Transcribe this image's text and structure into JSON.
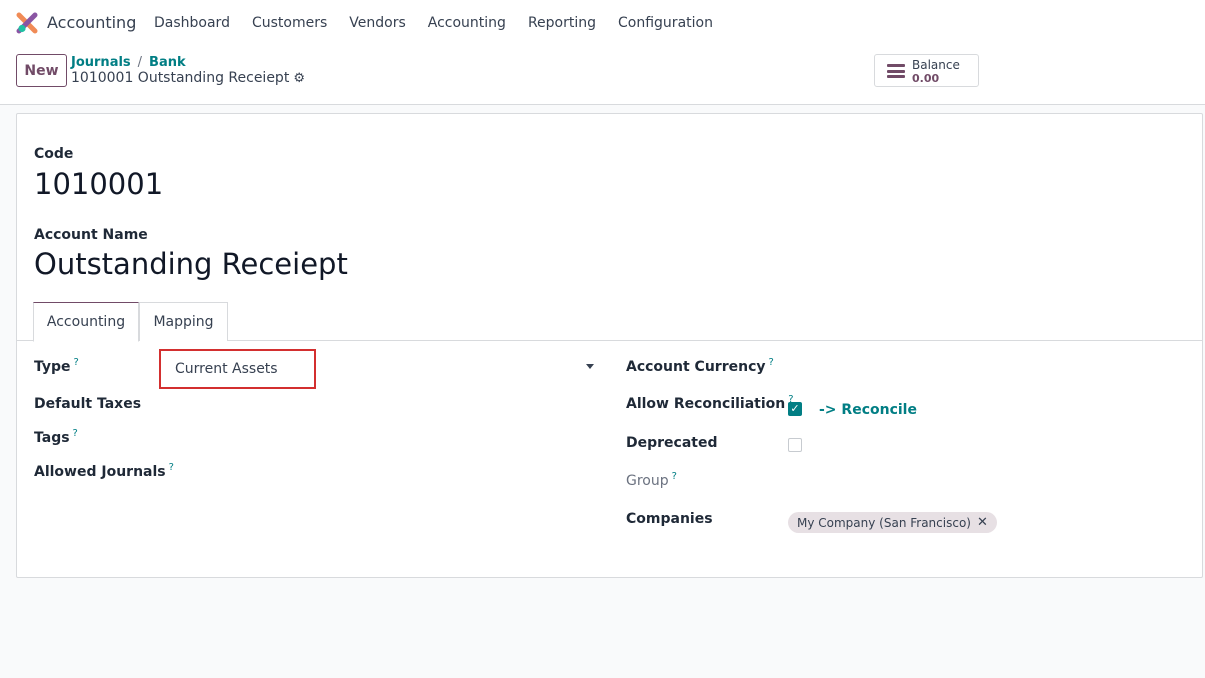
{
  "app": {
    "name": "Accounting"
  },
  "menu": [
    "Dashboard",
    "Customers",
    "Vendors",
    "Accounting",
    "Reporting",
    "Configuration"
  ],
  "control": {
    "new_label": "New",
    "breadcrumb": [
      "Journals",
      "Bank"
    ],
    "record_title": "1010001 Outstanding Receiept",
    "balance_label": "Balance",
    "balance_value": "0.00"
  },
  "form": {
    "code_label": "Code",
    "code_value": "1010001",
    "name_label": "Account Name",
    "name_value": "Outstanding Receiept",
    "tabs": [
      "Accounting",
      "Mapping"
    ],
    "help_mark": "?",
    "left_fields": {
      "type_label": "Type",
      "type_value": "Current Assets",
      "default_taxes_label": "Default Taxes",
      "tags_label": "Tags",
      "allowed_journals_label": "Allowed Journals"
    },
    "right_fields": {
      "account_currency_label": "Account Currency",
      "allow_reconciliation_label": "Allow Reconciliation",
      "allow_reconciliation_checked": true,
      "reconcile_link": "-> Reconcile",
      "deprecated_label": "Deprecated",
      "deprecated_checked": false,
      "group_label": "Group",
      "companies_label": "Companies",
      "company_tag": "My Company (San Francisco)"
    }
  },
  "colors": {
    "brand": "#714b67",
    "link": "#017e84",
    "highlight": "#d32f2f"
  },
  "icons": {
    "logo": "odoo-accounting-logo",
    "gear": "gear-icon",
    "balance": "list-icon",
    "check": "check-icon",
    "remove": "close-icon",
    "caret": "caret-down-icon"
  }
}
